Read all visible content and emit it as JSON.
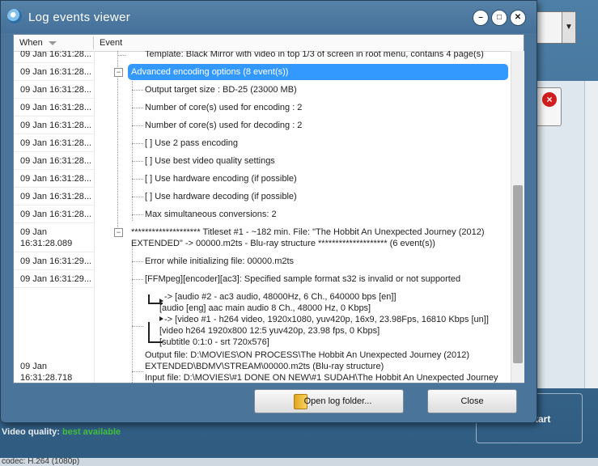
{
  "background": {
    "video_quality_label": "Video quality:",
    "video_quality_value": "best available",
    "start_label": "tart",
    "status_text": "codec: H.264 (1080p)"
  },
  "dialog": {
    "title": "Log events viewer",
    "columns": {
      "when": "When",
      "event": "Event"
    },
    "buttons": {
      "open_folder": "Open log folder...",
      "close": "Close"
    }
  },
  "log": {
    "when": [
      "09 Jan 16:31:28...",
      "09 Jan 16:31:28...",
      "09 Jan 16:31:28...",
      "09 Jan 16:31:28...",
      "09 Jan 16:31:28...",
      "09 Jan 16:31:28...",
      "09 Jan 16:31:28...",
      "09 Jan 16:31:28...",
      "09 Jan 16:31:28...",
      "09 Jan 16:31:28...",
      "09 Jan",
      "16:31:28.089",
      "09 Jan 16:31:29...",
      "09 Jan 16:31:29...",
      "09 Jan",
      "16:31:28.718"
    ],
    "events": {
      "template": "Template: Black Mirror with video in top 1/3 of screen in root menu, contains 4 page(s)",
      "advanced": "Advanced encoding options (8 event(s))",
      "opt1": "Output target size : BD-25 (23000 MB)",
      "opt2": "Number of core(s) used for encoding : 2",
      "opt3": "Number of core(s) used for decoding : 2",
      "opt4": "[ ] Use 2 pass encoding",
      "opt5": "[ ] Use best video quality settings",
      "opt6": "[ ] Use hardware encoding (if possible)",
      "opt7": "[ ] Use hardware decoding (if possible)",
      "opt8": "Max simultaneous conversions: 2",
      "titleset_1": "******************** Titleset #1 - ~182 min. File: \"The Hobbit An Unexpected Journey (2012)",
      "titleset_2": "EXTENDED\" -> 00000.m2ts - Blu-ray structure ******************** (6 event(s))",
      "err1": "Error while initializing file: 00000.m2ts",
      "err2": "[FFMpeg][encoder][ac3]: Specified sample format s32 is invalid or not supported",
      "map1": "-> [audio #2 - ac3 audio, 48000Hz, 6 Ch., 640000 bps [en]]",
      "map2": "[audio [eng] aac main audio 8 Ch., 48000 Hz, 0 Kbps]",
      "map3": "-> [video #1 - h264 video, 1920x1080, yuv420p, 16x9, 23.98Fps, 16810 Kbps [un]]",
      "map4": "[video h264 1920x800 12:5 yuv420p, 23.98 fps, 0 Kbps]",
      "map5": "[subtitle 0:1:0 - srt 720x576]",
      "out1": "Output file: D:\\MOVIES\\ON PROCESS\\The Hobbit An Unexpected Journey (2012)",
      "out2": "EXTENDED\\BDMV\\STREAM\\00000.m2ts (Blu-ray structure)",
      "inp1": "Input file: D:\\MOVIES\\#1 DONE ON NEW\\#1 SUDAH\\The Hobbit An Unexpected Journey"
    }
  }
}
